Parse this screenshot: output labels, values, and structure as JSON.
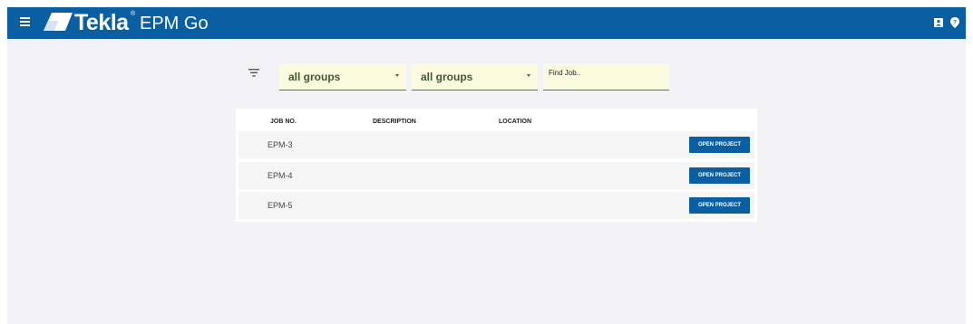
{
  "header": {
    "brand": "Tekla",
    "registered": "®",
    "product": "EPM Go",
    "bar_color": "#0a5fa3",
    "icons": [
      "menu-icon",
      "contact-card-icon",
      "help-icon"
    ]
  },
  "filters": {
    "group_select_1": "all groups",
    "group_select_2": "all groups",
    "search_placeholder": "Find Job..",
    "search_value": ""
  },
  "table": {
    "columns": [
      "JOB NO.",
      "DESCRIPTION",
      "LOCATION"
    ],
    "rows": [
      {
        "job_no": "EPM-3",
        "description": "",
        "location": "",
        "action": "OPEN PROJECT"
      },
      {
        "job_no": "EPM-4",
        "description": "",
        "location": "",
        "action": "OPEN PROJECT"
      },
      {
        "job_no": "EPM-5",
        "description": "",
        "location": "",
        "action": "OPEN PROJECT"
      }
    ]
  }
}
